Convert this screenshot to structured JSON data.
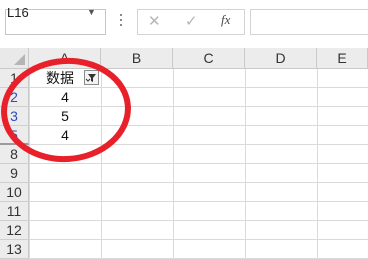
{
  "formula_bar": {
    "name_box": "L16",
    "fx_label": "fx",
    "cancel_symbol": "✕",
    "enter_symbol": "✓",
    "dropdown_symbol": "▼"
  },
  "columns": [
    "A",
    "B",
    "C",
    "D",
    "E"
  ],
  "rows": [
    "1",
    "2",
    "3",
    "5",
    "8",
    "9",
    "10",
    "11",
    "12",
    "13"
  ],
  "cells": {
    "A1": "数据",
    "A2": "4",
    "A3": "5",
    "A5": "4"
  },
  "colors": {
    "annotation_circle": "#e8202a",
    "filtered_row_number": "#2a4dba"
  },
  "icons": {
    "filter": "filter-funnel-icon"
  }
}
